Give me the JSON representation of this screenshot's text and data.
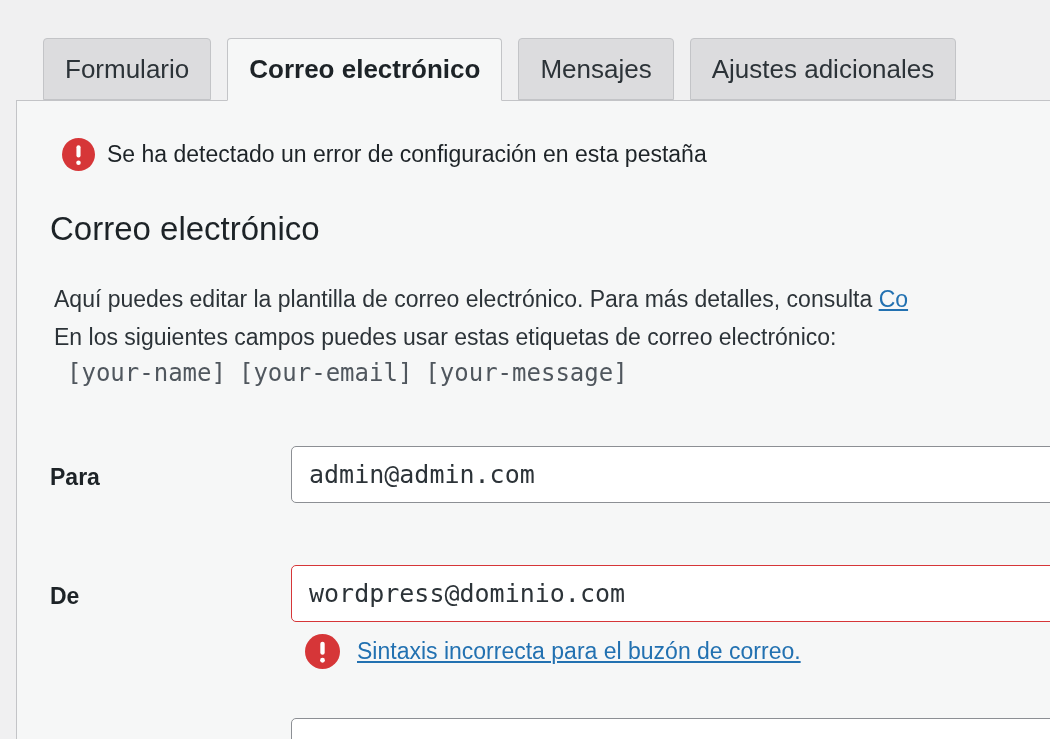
{
  "tabs": [
    {
      "label": "Formulario",
      "selected": false
    },
    {
      "label": "Correo electrónico",
      "selected": true
    },
    {
      "label": "Mensajes",
      "selected": false
    },
    {
      "label": "Ajustes adicionales",
      "selected": false
    }
  ],
  "notice": {
    "text": "Se ha detectado un error de configuración en esta pestaña"
  },
  "section": {
    "title": "Correo electrónico",
    "description": "Aquí puedes editar la plantilla de correo electrónico. Para más detalles, consulta",
    "description_link": "Co",
    "tags_intro": "En los siguientes campos puedes usar estas etiquetas de correo electrónico:",
    "tags": [
      "[your-name]",
      "[your-email]",
      "[your-message]"
    ]
  },
  "fields": [
    {
      "label": "Para",
      "value": "admin@admin.com",
      "invalid": false
    },
    {
      "label": "De",
      "value": "wordpress@dominio.com",
      "invalid": true,
      "error": "Sintaxis incorrecta para el buzón de correo."
    }
  ]
}
